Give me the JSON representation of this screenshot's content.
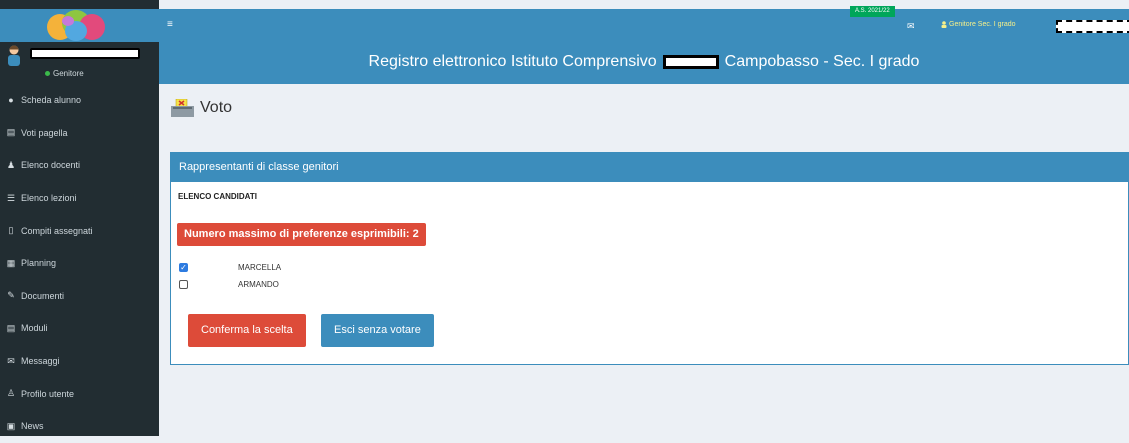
{
  "sidebar": {
    "user_status": "Genitore",
    "items": [
      {
        "label": "Scheda alunno",
        "icon": "user-icon"
      },
      {
        "label": "Voti pagella",
        "icon": "report-icon"
      },
      {
        "label": "Elenco docenti",
        "icon": "teachers-icon"
      },
      {
        "label": "Elenco lezioni",
        "icon": "list-icon"
      },
      {
        "label": "Compiti assegnati",
        "icon": "homework-icon"
      },
      {
        "label": "Planning",
        "icon": "calendar-icon"
      },
      {
        "label": "Documenti",
        "icon": "documents-icon"
      },
      {
        "label": "Moduli",
        "icon": "forms-icon"
      },
      {
        "label": "Messaggi",
        "icon": "envelope-icon"
      },
      {
        "label": "Profilo utente",
        "icon": "profile-icon"
      },
      {
        "label": "News",
        "icon": "news-icon"
      }
    ]
  },
  "topbar": {
    "menu_glyph": "≡",
    "year_badge": "A.S. 2021/22",
    "mail_glyph": "✉",
    "role": "Genitore Sec. I grado"
  },
  "header": {
    "title_prefix": "Registro elettronico Istituto Comprensivo",
    "title_suffix": "Campobasso - Sec. I grado"
  },
  "page": {
    "title": "Voto"
  },
  "panel": {
    "title": "Rappresentanti di classe genitori",
    "section": "ELENCO CANDIDATI",
    "max_pref": "Numero massimo di preferenze esprimibili: 2",
    "candidates": [
      {
        "name": "MARCELLA",
        "checked": true
      },
      {
        "name": "ARMANDO",
        "checked": false
      }
    ],
    "confirm_label": "Conferma la scelta",
    "exit_label": "Esci senza votare"
  },
  "colors": {
    "primary": "#3c8dbc",
    "danger": "#dd4b39",
    "sidebar": "#222d32",
    "success": "#00a65a"
  }
}
